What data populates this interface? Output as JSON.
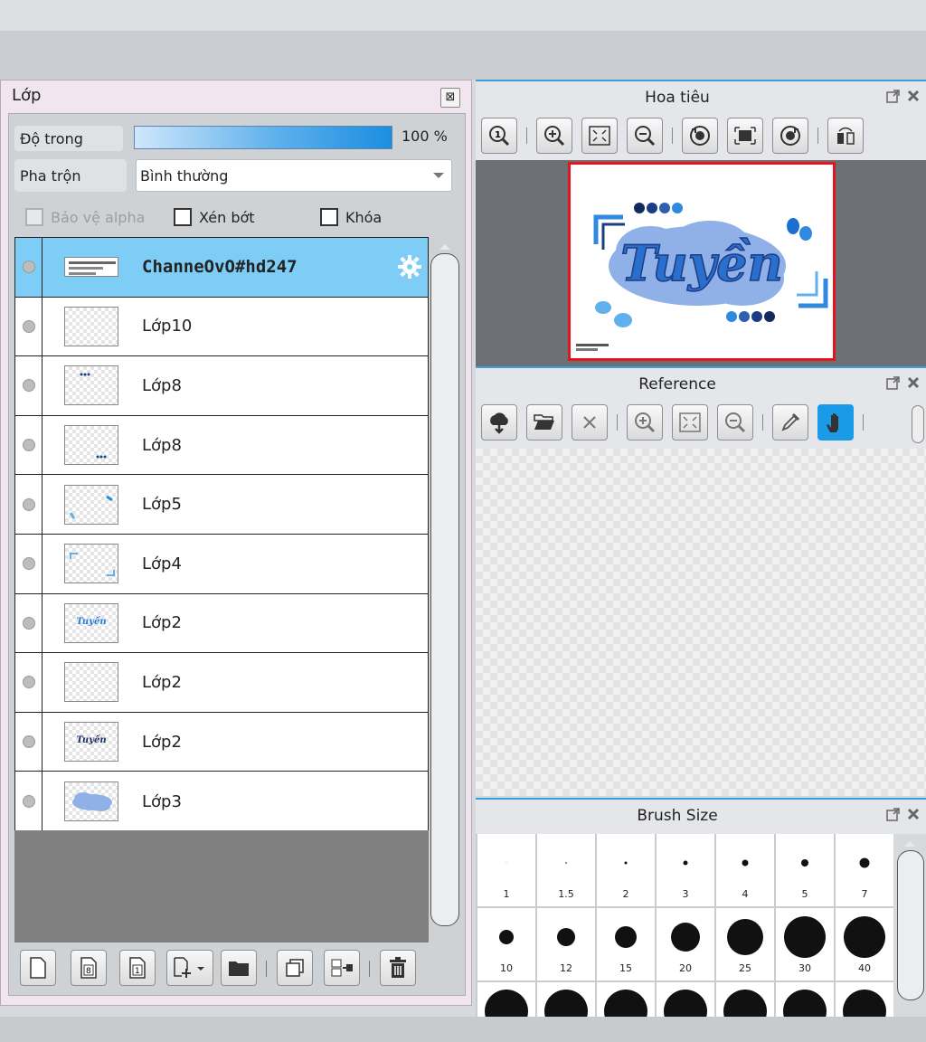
{
  "layers_panel": {
    "title": "Lớp",
    "close_label": "⊠",
    "opacity_label": "Độ trong",
    "opacity_value": "100 %",
    "opacity_fraction": 1.0,
    "blend_label": "Pha trộn",
    "blend_value": "Bình thường",
    "protect_alpha_label": "Bảo vệ alpha",
    "clip_label": "Xén bớt",
    "lock_label": "Khóa",
    "layers": [
      {
        "name": "ChanneOvO#hd247",
        "selected": true
      },
      {
        "name": "Lớp10"
      },
      {
        "name": "Lớp8"
      },
      {
        "name": "Lớp8"
      },
      {
        "name": "Lớp5"
      },
      {
        "name": "Lớp4"
      },
      {
        "name": "Lớp2"
      },
      {
        "name": "Lớp2"
      },
      {
        "name": "Lớp2"
      },
      {
        "name": "Lớp3"
      }
    ],
    "toolbar": {
      "icons": [
        "new-layer-icon",
        "new-8bit-layer-icon",
        "new-1bit-layer-icon",
        "add-layer-menu-icon",
        "new-folder-icon",
        "duplicate-layer-icon",
        "merge-down-icon",
        "delete-layer-icon"
      ]
    }
  },
  "navigator_panel": {
    "title": "Hoa tiêu",
    "preview_text": "Tuyền",
    "icons": [
      "zoom-actual-size-icon",
      "zoom-in-icon",
      "fit-to-window-icon",
      "zoom-out-icon",
      "rotate-left-icon",
      "fit-canvas-icon",
      "rotate-right-icon",
      "flip-horizontal-icon"
    ]
  },
  "reference_panel": {
    "title": "Reference",
    "icons": [
      "import-icon",
      "open-folder-icon",
      "close-x-icon",
      "zoom-in-icon",
      "fit-to-window-icon",
      "zoom-out-icon",
      "eyedropper-icon",
      "hand-icon"
    ]
  },
  "brush_size_panel": {
    "title": "Brush Size",
    "sizes": [
      "1",
      "1.5",
      "2",
      "3",
      "4",
      "5",
      "7",
      "10",
      "12",
      "15",
      "20",
      "25",
      "30",
      "40"
    ]
  },
  "colors": {
    "accent": "#3c9de2",
    "selected_row": "#7ecdf6",
    "active_tool": "#1a9be8",
    "navigator_frame": "#e3141b"
  }
}
